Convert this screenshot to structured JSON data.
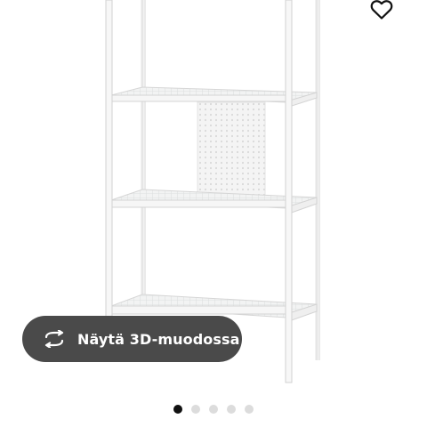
{
  "product": {
    "image_name": "white metal shelving unit with mesh shelves"
  },
  "favorite": {
    "icon": "heart-icon"
  },
  "view_3d": {
    "label": "Näytä 3D-muodossa",
    "icon": "rotate-3d-icon"
  },
  "carousel": {
    "count": 5,
    "active_index": 0
  },
  "colors": {
    "button_bg": "#4a4a4a",
    "button_text": "#ffffff",
    "dot_active": "#111111",
    "dot_inactive": "#dcdcdc"
  }
}
